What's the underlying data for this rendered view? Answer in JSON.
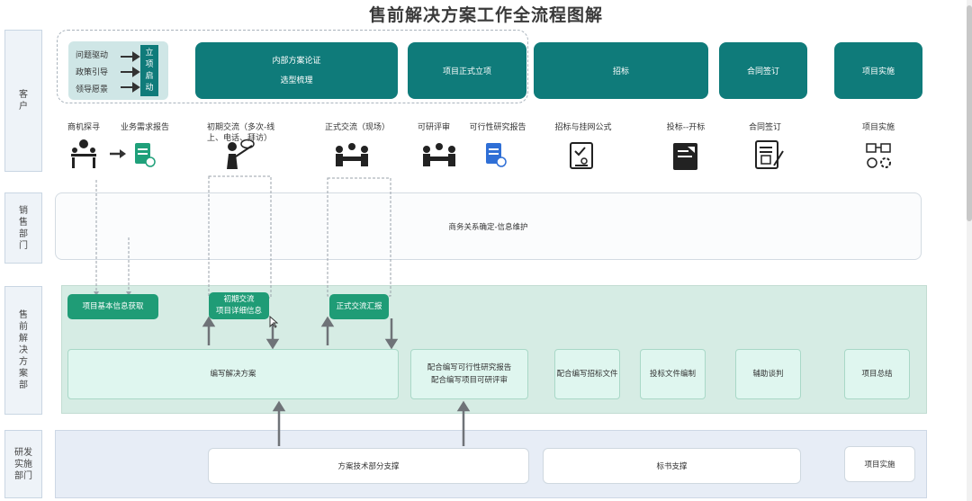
{
  "title": "售前解决方案工作全流程图解",
  "lanes": {
    "customer": "客户",
    "sales": "销售部门",
    "presales": "售前解决方案部",
    "rd": "研发 实施 部门"
  },
  "drivers": [
    "问题驱动",
    "政策引导",
    "领导愿景"
  ],
  "project_start": "立项启动",
  "phases": {
    "internal_review": [
      "内部方案论证",
      "选型梳理"
    ],
    "project_setup": "项目正式立项",
    "bidding": "招标",
    "contract": "合同签订",
    "implementation": "项目实施"
  },
  "steps": {
    "opportunity": "商机探寻",
    "requirement_report": "业务需求报告",
    "initial_exchange": "初期交流（多次-线上、电话、拜访）",
    "formal_exchange": "正式交流（现场）",
    "feasibility_review": "可研评审",
    "feasibility_report": "可行性研究报告",
    "bid_publicity": "招标与挂网公式",
    "bid_submit": "投标--开标",
    "contract_sign": "合同签订",
    "project_impl": "项目实施"
  },
  "sales_box": "商务关系确定-信息维护",
  "presales": {
    "info_fetch": "项目基本信息获取",
    "initial_exchange": "初期交流\n项目详细信息",
    "formal_report": "正式交流汇报",
    "write_solution": "编写解决方案",
    "feasibility_assist": "配合编写可行性研究报告\n配合编写项目可研评审",
    "bid_doc_assist": "配合编写招标文件",
    "bid_file_write": "投标文件编制",
    "negotiation": "辅助谈判",
    "summary": "项目总结"
  },
  "rd": {
    "tech_support": "方案技术部分支撑",
    "bid_support": "标书支撑",
    "impl": "项目实施"
  },
  "icons": [
    "meeting-icon",
    "document-icon",
    "presenter-icon",
    "team-meeting-icon",
    "team-meeting-icon",
    "document-icon",
    "checklist-icon",
    "bid-board-icon",
    "contract-icon",
    "implementation-icon"
  ]
}
